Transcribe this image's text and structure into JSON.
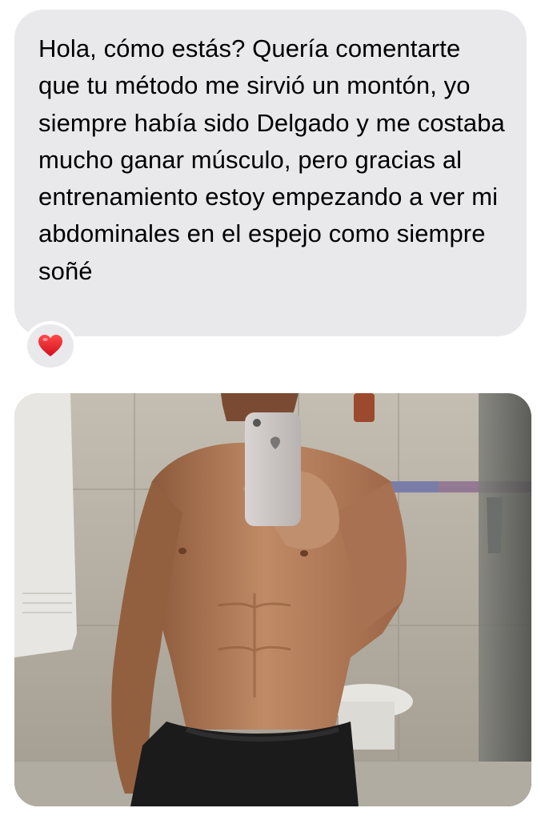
{
  "message": {
    "text": "Hola, cómo estás? Quería comentarte que tu método me sirvió un montón, yo siempre había sido Delgado y me costaba mucho ganar músculo, pero gracias al entrenamiento estoy empezando a ver mi abdominales en el espejo como siempre soñé",
    "bubble_color": "#e9e9eb"
  },
  "reaction": {
    "icon": "heart-icon",
    "color": "#e8202a"
  },
  "attachment": {
    "type": "photo",
    "subject": "mirror-selfie"
  }
}
